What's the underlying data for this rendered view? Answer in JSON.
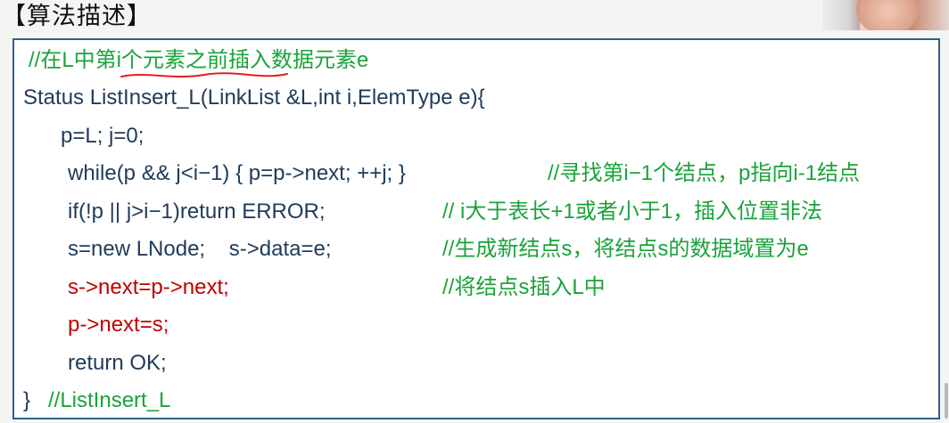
{
  "heading": "【算法描述】",
  "code": {
    "line1": {
      "comment": "//在L中第i个元素之前插入数据元素e"
    },
    "line2": {
      "text": "Status ListInsert_L(LinkList &L,int i,ElemType e){"
    },
    "line3": {
      "text": "p=L; j=0;"
    },
    "line4": {
      "code": "while(p && j<i−1) { p=p->next; ++j; }",
      "comment": "//寻找第i−1个结点，p指向i-1结点"
    },
    "line5": {
      "code": "if(!p || j>i−1)return ERROR;",
      "comment": "// i大于表长+1或者小于1，插入位置非法"
    },
    "line6": {
      "code": "s=new LNode;    s->data=e;",
      "comment": "//生成新结点s，将结点s的数据域置为e"
    },
    "line7": {
      "code": "s->next=p->next;",
      "comment": "//将结点s插入L中"
    },
    "line8": {
      "code": "p->next=s;"
    },
    "line9": {
      "text": "return OK;"
    },
    "line10": {
      "code": "}",
      "comment": "//ListInsert_L"
    }
  },
  "colors": {
    "comment": "#1aa33a",
    "code": "#1f3b59",
    "highlight": "#c00000",
    "border": "#2f5f8f",
    "annotation": "#e02020"
  }
}
